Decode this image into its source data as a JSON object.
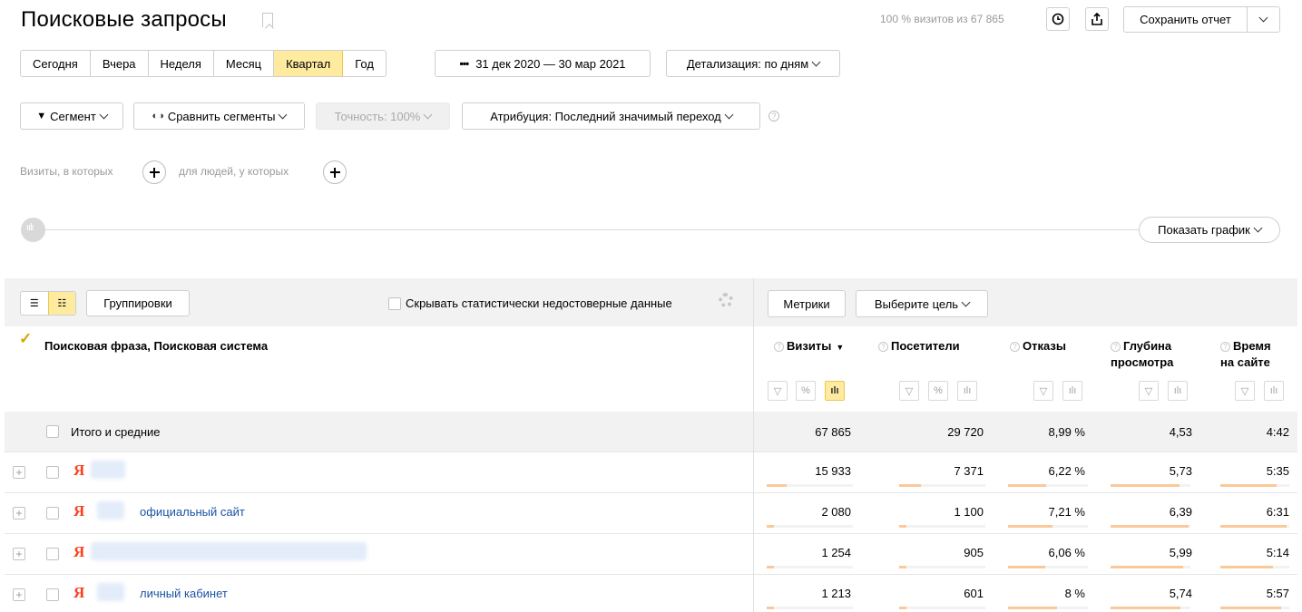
{
  "header": {
    "title": "Поисковые запросы",
    "visits_info": "100 % визитов из 67 865",
    "save_report": "Сохранить отчет"
  },
  "period_tabs": [
    {
      "label": "Сегодня",
      "active": false
    },
    {
      "label": "Вчера",
      "active": false
    },
    {
      "label": "Неделя",
      "active": false
    },
    {
      "label": "Месяц",
      "active": false
    },
    {
      "label": "Квартал",
      "active": true
    },
    {
      "label": "Год",
      "active": false
    }
  ],
  "date_range": "31 дек 2020 — 30 мар 2021",
  "detail": "Детализация: по дням",
  "filters": {
    "segment": "Сегмент",
    "compare": "Сравнить сегменты",
    "accuracy": "Точность: 100%",
    "attribution": "Атрибуция: Последний значимый переход"
  },
  "segment_builder": {
    "visits_label": "Визиты, в которых",
    "people_label": "для людей, у которых"
  },
  "show_chart": "Показать график",
  "toolbar": {
    "groupings": "Группировки",
    "hide_unreliable": "Скрывать статистически недостоверные данные",
    "metrics": "Метрики",
    "choose_goal": "Выберите цель"
  },
  "table": {
    "dimension_header": "Поисковая фраза, Поисковая система",
    "columns": [
      {
        "line1": "Визиты",
        "line2": "",
        "sorted": true
      },
      {
        "line1": "Посетители",
        "line2": ""
      },
      {
        "line1": "Отказы",
        "line2": ""
      },
      {
        "line1": "Глубина",
        "line2": "просмотра"
      },
      {
        "line1": "Время",
        "line2": "на сайте"
      }
    ],
    "totals": {
      "label": "Итого и средние",
      "values": [
        "67 865",
        "29 720",
        "8,99 %",
        "4,53",
        "4:42"
      ]
    },
    "rows": [
      {
        "search_engine_icon": "yandex-logo",
        "text": "",
        "values": [
          "15 933",
          "7 371",
          "6,22 %",
          "5,73",
          "5:35"
        ],
        "shares": [
          0.235,
          0.248,
          0.692,
          1.26,
          1.19
        ]
      },
      {
        "search_engine_icon": "yandex-logo",
        "text": "официальный сайт",
        "values": [
          "2 080",
          "1 100",
          "7,21 %",
          "6,39",
          "6:31"
        ],
        "shares": [
          0.031,
          0.037,
          0.802,
          1.41,
          1.39
        ]
      },
      {
        "search_engine_icon": "yandex-logo",
        "text": "",
        "values": [
          "1 254",
          "905",
          "6,06 %",
          "5,99",
          "5:14"
        ],
        "shares": [
          0.018,
          0.03,
          0.674,
          1.32,
          1.11
        ]
      },
      {
        "search_engine_icon": "yandex-logo",
        "text": "личный кабинет",
        "values": [
          "1 213",
          "601",
          "8 %",
          "5,74",
          "5:57"
        ],
        "shares": [
          0.018,
          0.02,
          0.89,
          1.27,
          1.27
        ]
      }
    ]
  }
}
